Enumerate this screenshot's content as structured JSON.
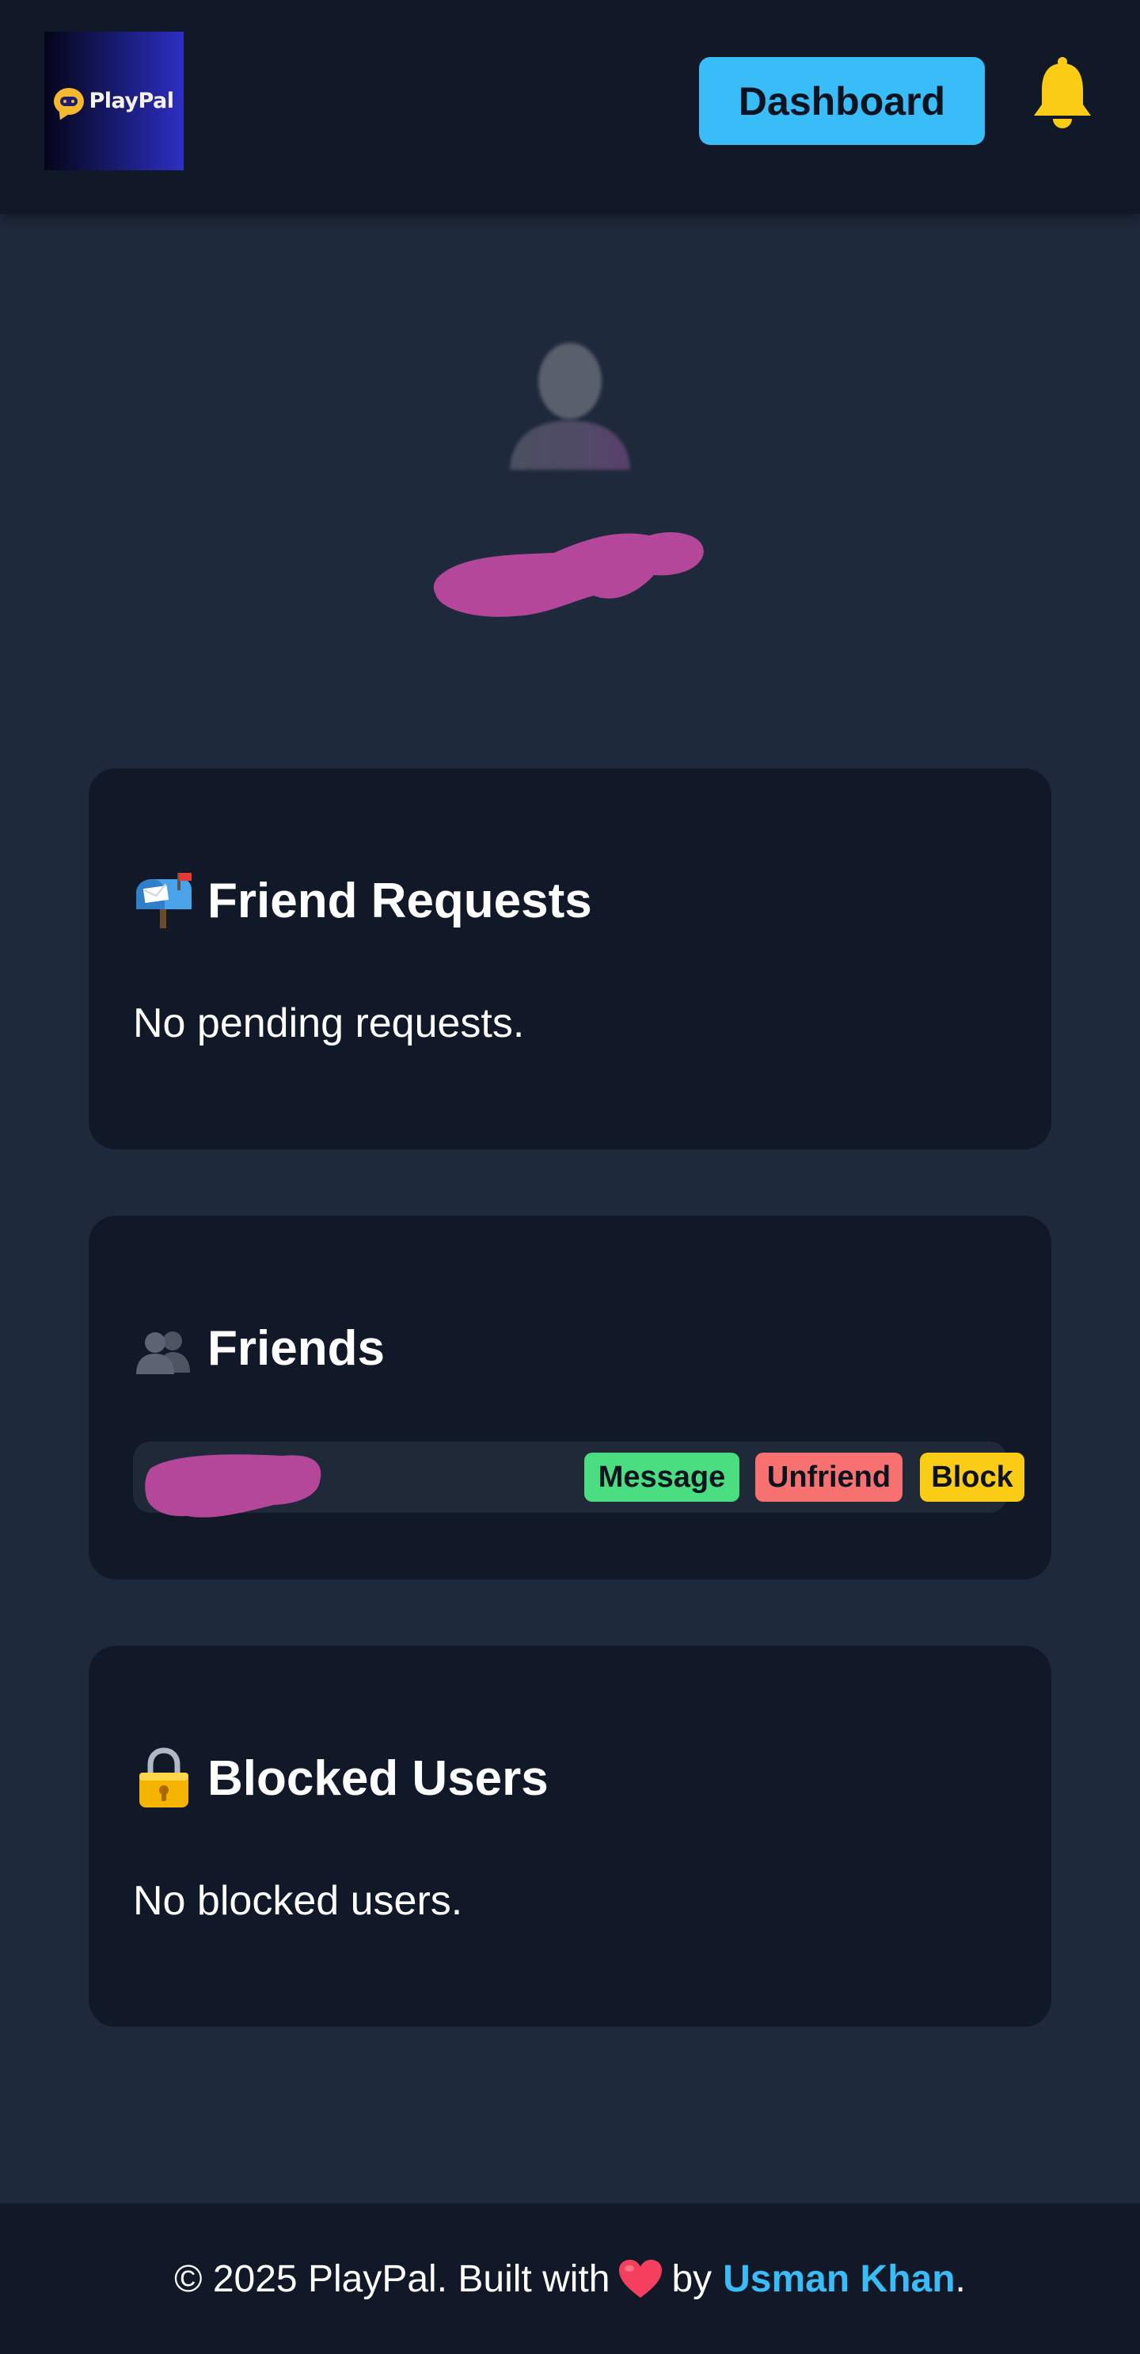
{
  "header": {
    "logo_text": "PlayPal",
    "dashboard_label": "Dashboard",
    "bell_icon": "bell-icon",
    "accent_color": "#38bdf8",
    "bell_color": "#facc15"
  },
  "profile": {
    "avatar_icon": "user-silhouette-icon"
  },
  "friend_requests": {
    "icon": "mailbox-icon",
    "title": "Friend Requests",
    "empty_text": "No pending requests."
  },
  "friends": {
    "icon": "two-users-icon",
    "title": "Friends",
    "actions": {
      "message": "Message",
      "unfriend": "Unfriend",
      "block": "Block"
    },
    "action_colors": {
      "message": "#4ade80",
      "unfriend": "#f87171",
      "block": "#facc15"
    }
  },
  "blocked_users": {
    "icon": "padlock-icon",
    "title": "Blocked Users",
    "empty_text": "No blocked users."
  },
  "footer": {
    "prefix": "© 2025 PlayPal. Built with",
    "heart_icon": "heart-icon",
    "by_text": "by",
    "author": "Usman Khan",
    "suffix": "."
  }
}
